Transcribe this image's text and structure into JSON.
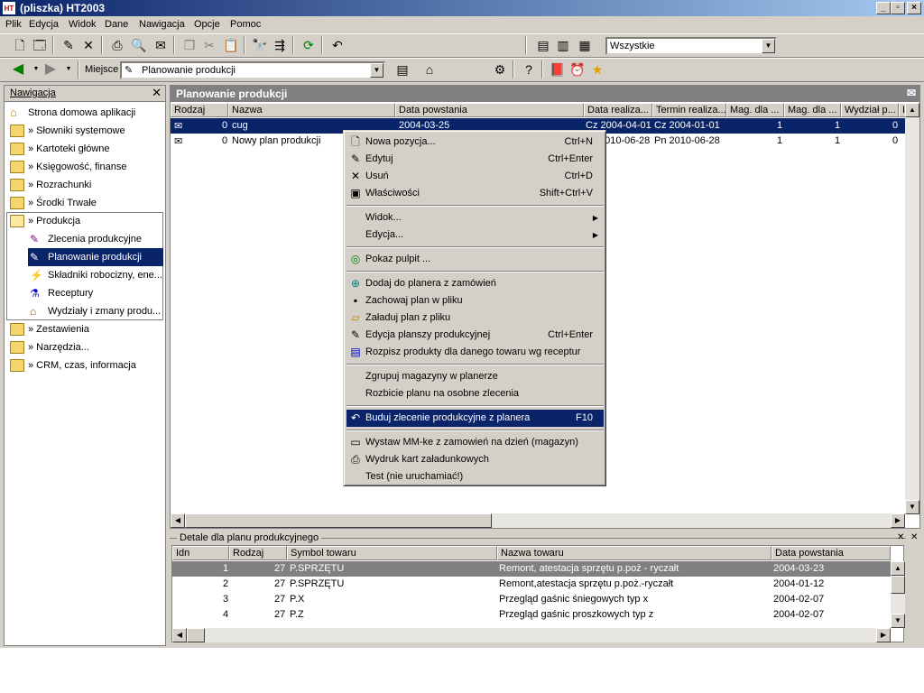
{
  "window": {
    "title": "(pliszka)  HT2003",
    "app_badge": "HT"
  },
  "menubar": [
    "Plik",
    "Edycja",
    "Widok",
    "Dane",
    "Nawigacja",
    "Opcje",
    "Pomoc"
  ],
  "toolbar": {
    "filter_value": "Wszystkie",
    "location_label": "Miejsce",
    "location_value": "Planowanie produkcji"
  },
  "nav": {
    "title": "Nawigacja",
    "items": [
      {
        "label": "Strona domowa aplikacji",
        "icon": "home-icon"
      },
      {
        "label": "» Słowniki systemowe",
        "icon": "folder-icon"
      },
      {
        "label": "» Kartoteki główne",
        "icon": "folder-icon"
      },
      {
        "label": "» Księgowość, finanse",
        "icon": "folder-icon"
      },
      {
        "label": "» Rozrachunki",
        "icon": "folder-icon"
      },
      {
        "label": "» Środki Trwałe",
        "icon": "folder-icon"
      },
      {
        "label": "» Produkcja",
        "icon": "folder-open-icon"
      },
      {
        "label": "Zlecenia produkcyjne",
        "icon": "orders-icon"
      },
      {
        "label": "Planowanie produkcji",
        "icon": "planning-icon",
        "selected": true
      },
      {
        "label": "Składniki robocizny, ene...",
        "icon": "components-icon"
      },
      {
        "label": "Receptury",
        "icon": "flask-icon"
      },
      {
        "label": "Wydziały i zmany produ...",
        "icon": "factory-icon"
      },
      {
        "label": "» Zestawienia",
        "icon": "folder-icon"
      },
      {
        "label": "» Narzędzia...",
        "icon": "folder-icon"
      },
      {
        "label": "» CRM, czas, informacja",
        "icon": "folder-icon"
      }
    ]
  },
  "grid": {
    "title": "Planowanie produkcji",
    "columns": [
      "Rodzaj",
      "Nazwa",
      "Data powstania",
      "Data realiza...",
      "Termin realiza...",
      "Mag. dla ...",
      "Mag. dla ...",
      "Wydział p...",
      "I"
    ],
    "rows": [
      {
        "rodzaj": "0",
        "nazwa": "cug",
        "data_powstania": "2004-03-25",
        "data_realizacji": "Cz 2004-04-01",
        "termin": "Cz 2004-01-01",
        "mag1": "1",
        "mag2": "1",
        "wydzial": "0"
      },
      {
        "rodzaj": "0",
        "nazwa": "Nowy plan produkcji",
        "data_powstania": "",
        "data_realizacji": "2010-06-28",
        "termin": "Pn 2010-06-28",
        "mag1": "1",
        "mag2": "1",
        "wydzial": "0"
      }
    ]
  },
  "context_menu": {
    "items": [
      {
        "label": "Nowa pozycja...",
        "shortcut": "Ctrl+N",
        "icon": "new-doc-icon"
      },
      {
        "label": "Edytuj",
        "shortcut": "Ctrl+Enter",
        "icon": "edit-icon"
      },
      {
        "label": "Usuń",
        "shortcut": "Ctrl+D",
        "icon": "delete-icon"
      },
      {
        "label": "Właściwości",
        "shortcut": "Shift+Ctrl+V",
        "icon": "properties-icon"
      },
      {
        "label": "Widok...",
        "submenu": true
      },
      {
        "label": "Edycja...",
        "submenu": true
      },
      {
        "label": "Pokaz pulpit ...",
        "icon": "desktop-icon"
      },
      {
        "label": "Dodaj do planera z zamówień",
        "icon": "add-icon"
      },
      {
        "label": "Zachowaj plan w pliku",
        "icon": "save-icon"
      },
      {
        "label": "Załaduj plan z pliku",
        "icon": "open-icon"
      },
      {
        "label": "Edycja planszy produkcyjnej",
        "shortcut": "Ctrl+Enter",
        "icon": "board-icon"
      },
      {
        "label": "Rozpisz produkty dla danego towaru wg receptur",
        "icon": "list-icon"
      },
      {
        "label": "Zgrupuj magazyny w planerze"
      },
      {
        "label": "Rozbicie planu na osobne zlecenia"
      },
      {
        "label": "Buduj zlecenie produkcyjne z planera",
        "shortcut": "F10",
        "icon": "build-icon",
        "highlighted": true
      },
      {
        "label": "Wystaw MM-ke z zamowień na dzień (magazyn)",
        "icon": "transfer-icon"
      },
      {
        "label": "Wydruk kart załadunkowych",
        "icon": "print-icon"
      },
      {
        "label": "Test (nie uruchamiać!)"
      }
    ]
  },
  "details": {
    "title": "Detale dla planu produkcyjnego",
    "columns": [
      "Idn",
      "Rodzaj",
      "Symbol towaru",
      "Nazwa towaru",
      "Data powstania"
    ],
    "rows": [
      {
        "idn": "1",
        "rodzaj": "27",
        "symbol": "P.SPRZĘTU",
        "nazwa": "Remont, atestacja sprzętu p.poż - ryczałt",
        "data": "2004-03-23"
      },
      {
        "idn": "2",
        "rodzaj": "27",
        "symbol": "P.SPRZĘTU",
        "nazwa": "Remont,atestacja sprzętu p.poż.-ryczałt",
        "data": "2004-01-12"
      },
      {
        "idn": "3",
        "rodzaj": "27",
        "symbol": "P.X",
        "nazwa": "Przegląd gaśnic śniegowych typ x",
        "data": "2004-02-07"
      },
      {
        "idn": "4",
        "rodzaj": "27",
        "symbol": "P.Z",
        "nazwa": "Przegląd gaśnic proszkowych typ z",
        "data": "2004-02-07"
      }
    ]
  }
}
